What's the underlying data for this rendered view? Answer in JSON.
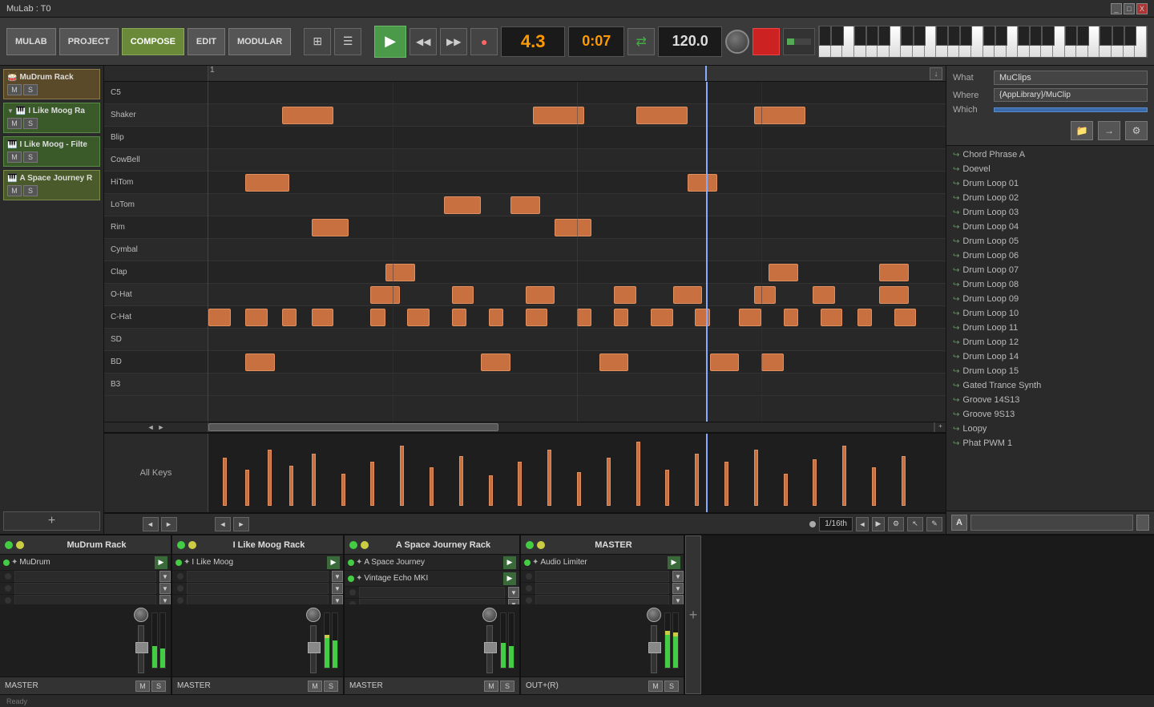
{
  "titlebar": {
    "title": "MuLab : T0",
    "controls": [
      "_",
      "□",
      "X"
    ]
  },
  "toolbar": {
    "mulab_label": "MULAB",
    "project_label": "PROJECT",
    "compose_label": "COMPOSE",
    "edit_label": "EDIT",
    "modular_label": "MODULAR",
    "position": "4.3",
    "time": "0:07",
    "bpm": "120.0",
    "play_icon": "▶",
    "rewind_icon": "◀◀",
    "forward_icon": "▶▶",
    "record_icon": "●"
  },
  "tracks": [
    {
      "name": "MuDrum Rack",
      "color": "#8a6a2a",
      "has_expand": false,
      "icon": "drum"
    },
    {
      "name": "I Like Moog Ra",
      "color": "#4a6a2a",
      "has_expand": true,
      "icon": "synth"
    },
    {
      "name": "I Like Moog - Filte",
      "color": "#4a6a2a",
      "has_expand": false,
      "icon": "synth"
    },
    {
      "name": "A Space Journey R",
      "color": "#6a6a2a",
      "has_expand": false,
      "icon": "synth"
    }
  ],
  "note_labels": [
    "C5",
    "Shaker",
    "Blip",
    "CowBell",
    "HiTom",
    "LoTom",
    "Rim",
    "Cymbal",
    "Clap",
    "O-Hat",
    "C-Hat",
    "SD",
    "BD",
    "B3"
  ],
  "right_sidebar": {
    "what_label": "What",
    "what_value": "MuClips",
    "where_label": "Where",
    "where_value": "{AppLibrary}/MuClip",
    "which_label": "Which",
    "which_value": "",
    "folder_icon": "📁",
    "arrow_icon": "→",
    "gear_icon": "⚙",
    "files": [
      "Chord Phrase A",
      "Doevel",
      "Drum Loop 01",
      "Drum Loop 02",
      "Drum Loop 03",
      "Drum Loop 04",
      "Drum Loop 05",
      "Drum Loop 06",
      "Drum Loop 07",
      "Drum Loop 08",
      "Drum Loop 09",
      "Drum Loop 10",
      "Drum Loop 11",
      "Drum Loop 12",
      "Drum Loop 14",
      "Drum Loop 15",
      "Gated Trance Synth",
      "Groove 14S13",
      "Groove 9S13",
      "Loopy",
      "Phat PWM 1"
    ]
  },
  "mini_view": {
    "label": "All Keys"
  },
  "timeline": {
    "quantize": "1/16th"
  },
  "mixer": {
    "racks": [
      {
        "id": "mudrum",
        "title": "MuDrum Rack",
        "channels": [
          {
            "name": "MuDrum",
            "active": true
          },
          {
            "name": "",
            "active": false
          },
          {
            "name": "",
            "active": false
          },
          {
            "name": "",
            "active": false
          },
          {
            "name": "",
            "active": false
          }
        ],
        "footer_label": "MASTER"
      },
      {
        "id": "moog",
        "title": "I Like Moog Rack",
        "channels": [
          {
            "name": "I Like Moog",
            "active": true
          },
          {
            "name": "",
            "active": false
          },
          {
            "name": "",
            "active": false
          },
          {
            "name": "",
            "active": false
          },
          {
            "name": "",
            "active": false
          }
        ],
        "footer_label": "MASTER"
      },
      {
        "id": "space",
        "title": "A Space Journey Rack",
        "channels": [
          {
            "name": "A Space Journey",
            "active": true
          },
          {
            "name": "Vintage Echo MKI",
            "active": true
          },
          {
            "name": "",
            "active": false
          },
          {
            "name": "",
            "active": false
          },
          {
            "name": "",
            "active": false
          }
        ],
        "footer_label": "MASTER"
      },
      {
        "id": "master",
        "title": "MASTER",
        "channels": [
          {
            "name": "Audio Limiter",
            "active": true
          },
          {
            "name": "",
            "active": false
          },
          {
            "name": "",
            "active": false
          },
          {
            "name": "",
            "active": false
          },
          {
            "name": "",
            "active": false
          }
        ],
        "footer_label": "OUT+(R)"
      }
    ]
  }
}
